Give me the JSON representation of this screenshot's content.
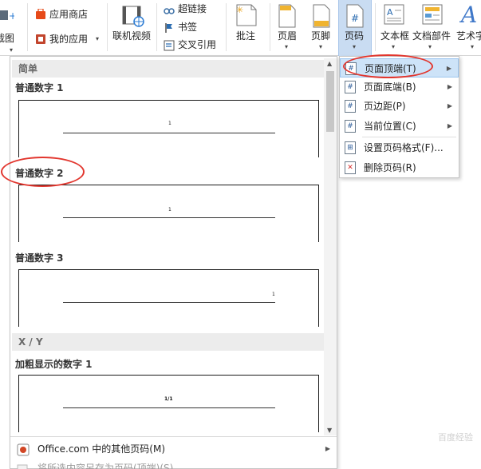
{
  "ribbon": {
    "screenshot_label": "截图",
    "app_store": "应用商店",
    "my_apps": "我的应用",
    "online_video": "联机视频",
    "hyperlink": "超链接",
    "bookmark": "书签",
    "cross_reference": "交叉引用",
    "comment": "批注",
    "header": "页眉",
    "footer": "页脚",
    "page_number": "页码",
    "text_box": "文本框",
    "quick_parts": "文档部件",
    "wordart": "艺术字"
  },
  "gallery": {
    "section_simple": "简单",
    "items": [
      {
        "title": "普通数字 1",
        "num": "1",
        "align": "center"
      },
      {
        "title": "普通数字 2",
        "num": "1",
        "align": "center"
      },
      {
        "title": "普通数字 3",
        "num": "1",
        "align": "right"
      }
    ],
    "section_xy": "X / Y",
    "bold_item": {
      "title": "加粗显示的数字 1",
      "num": "1/1"
    },
    "more_from_office": "Office.com 中的其他页码(M)",
    "save_selection": "将所选内容另存为页码(顶端)(S)"
  },
  "submenu": {
    "items": [
      {
        "label": "页面顶端(T)",
        "icon": "#",
        "has_arrow": true,
        "highlight": true
      },
      {
        "label": "页面底端(B)",
        "icon": "#",
        "has_arrow": true,
        "highlight": false
      },
      {
        "label": "页边距(P)",
        "icon": "#",
        "has_arrow": true,
        "highlight": false
      },
      {
        "label": "当前位置(C)",
        "icon": "#",
        "has_arrow": true,
        "highlight": false
      },
      {
        "label": "设置页码格式(F)...",
        "icon": "⊞",
        "has_arrow": false,
        "highlight": false
      },
      {
        "label": "删除页码(R)",
        "icon": "✕",
        "has_arrow": false,
        "highlight": false
      }
    ]
  },
  "watermark": "百度经验",
  "colors": {
    "accent_blue": "#2b579a",
    "highlight": "#cde3f8",
    "annotation_red": "#e2362e",
    "office_orange": "#d24726"
  }
}
